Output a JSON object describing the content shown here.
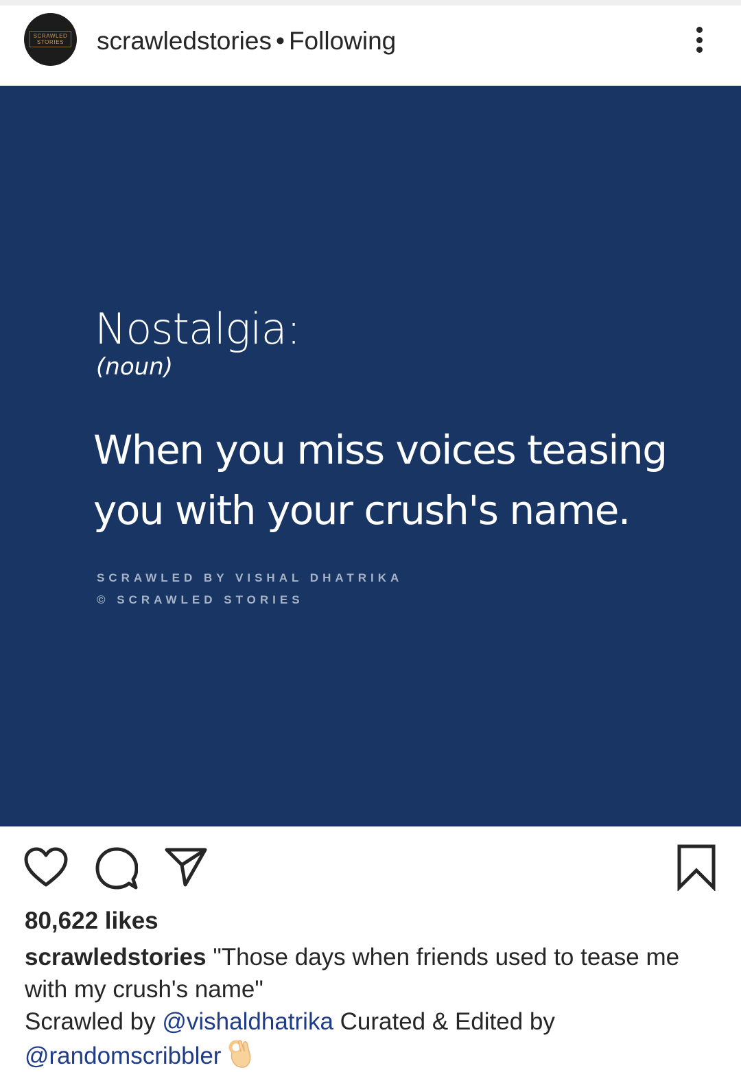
{
  "header": {
    "username": "scrawledstories",
    "separator": "•",
    "follow_status": "Following",
    "avatar_text_line1": "SCRAWLED",
    "avatar_text_line2": "STORIES"
  },
  "post_image": {
    "background_color": "#183563",
    "title": "Nostalgia:",
    "part_of_speech": "(noun)",
    "definition": "When you miss voices teasing you with your crush's name.",
    "credit_line1": "SCRAWLED BY VISHAL DHATRIKA",
    "credit_line2": "© SCRAWLED STORIES"
  },
  "actions": {
    "icons": [
      "heart-icon",
      "comment-icon",
      "share-icon",
      "bookmark-icon"
    ]
  },
  "likes": "80,622 likes",
  "caption": {
    "username": "scrawledstories",
    "text_part1": " \"Those days when friends used to tease me with my crush's name\"",
    "text_part2": "Scrawled by ",
    "mention1": "@vishaldhatrika",
    "text_part3": " Curated & Edited by ",
    "mention2": "@randomscribbler",
    "emoji": "ok-hand-emoji",
    "mention_color": "#1f3c88"
  }
}
